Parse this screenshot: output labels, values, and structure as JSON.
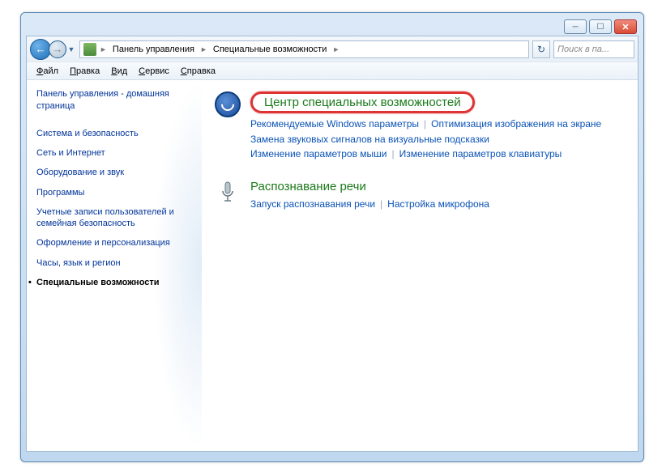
{
  "titlebar": {
    "minimize": "─",
    "maximize": "☐",
    "close": "✕"
  },
  "address": {
    "back": "←",
    "forward": "→",
    "dropdown": "▼",
    "crumbs": [
      "Панель управления",
      "Специальные возможности"
    ],
    "sep": "►",
    "refresh": "↻",
    "search_placeholder": "Поиск в па..."
  },
  "menubar": [
    {
      "u": "Ф",
      "rest": "айл"
    },
    {
      "u": "П",
      "rest": "равка"
    },
    {
      "u": "В",
      "rest": "ид"
    },
    {
      "u": "С",
      "rest": "ервис"
    },
    {
      "u": "С",
      "rest": "правка"
    }
  ],
  "sidebar": {
    "home": "Панель управления - домашняя страница",
    "items": [
      "Система и безопасность",
      "Сеть и Интернет",
      "Оборудование и звук",
      "Программы",
      "Учетные записи пользователей и семейная безопасность",
      "Оформление и персонализация",
      "Часы, язык и регион",
      "Специальные возможности"
    ],
    "activeIndex": 7
  },
  "main": {
    "cat1": {
      "title": "Центр специальных возможностей",
      "links": [
        "Рекомендуемые Windows параметры",
        "Оптимизация изображения на экране",
        "Замена звуковых сигналов на визуальные подсказки",
        "Изменение параметров мыши",
        "Изменение параметров клавиатуры"
      ]
    },
    "cat2": {
      "title": "Распознавание речи",
      "links": [
        "Запуск распознавания речи",
        "Настройка микрофона"
      ]
    }
  }
}
